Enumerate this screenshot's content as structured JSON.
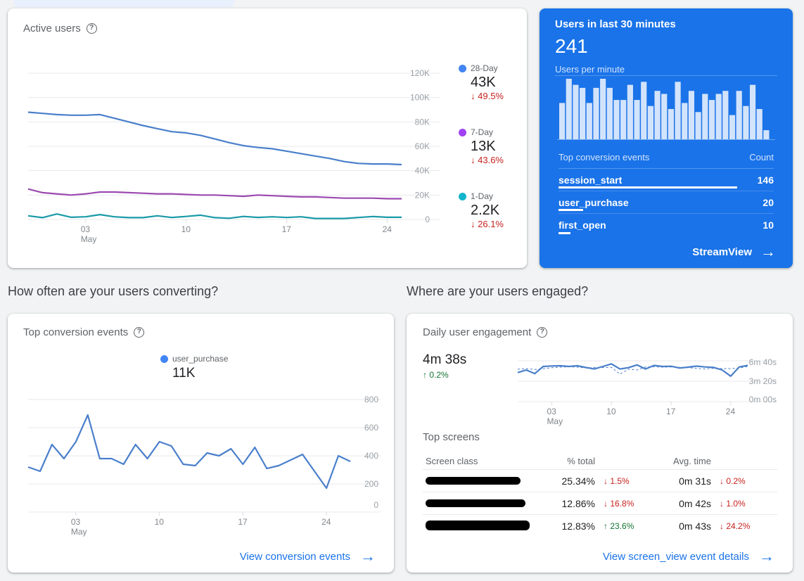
{
  "active_users": {
    "title": "Active users",
    "legend": [
      {
        "label": "28-Day",
        "value": "43K",
        "change": "49.5%",
        "direction": "down",
        "color": "#4285f4"
      },
      {
        "label": "7-Day",
        "value": "13K",
        "change": "43.6%",
        "direction": "down",
        "color": "#a142f4"
      },
      {
        "label": "1-Day",
        "value": "2.2K",
        "change": "26.1%",
        "direction": "down",
        "color": "#12b5cb"
      }
    ]
  },
  "realtime": {
    "title": "Users in last 30 minutes",
    "value": "241",
    "subtitle": "Users per minute",
    "table_header": {
      "name": "Top conversion events",
      "count": "Count"
    },
    "events": [
      {
        "name": "session_start",
        "count": "146",
        "share": 1.0
      },
      {
        "name": "user_purchase",
        "count": "20",
        "share": 0.137
      },
      {
        "name": "first_open",
        "count": "10",
        "share": 0.068
      }
    ],
    "link_label": "StreamView"
  },
  "sections": {
    "converting": "How often are your users converting?",
    "engaged": "Where are your users engaged?"
  },
  "conversions": {
    "title": "Top conversion events",
    "legend_label": "user_purchase",
    "legend_value": "11K",
    "link_label": "View conversion events"
  },
  "engagement": {
    "title": "Daily user engagement",
    "value": "4m 38s",
    "change": "0.2%",
    "screens_title": "Top screens",
    "headers": {
      "screen": "Screen class",
      "pct": "% total",
      "time": "Avg. time"
    },
    "rows": [
      {
        "screen": "[redacted]",
        "pct": "25.34%",
        "pct_change": "1.5%",
        "pct_dir": "down",
        "time": "0m 31s",
        "time_change": "0.2%",
        "time_dir": "down"
      },
      {
        "screen": "[redacted]",
        "pct": "12.86%",
        "pct_change": "16.8%",
        "pct_dir": "down",
        "time": "0m 42s",
        "time_change": "1.0%",
        "time_dir": "down"
      },
      {
        "screen": "[redacted]",
        "pct": "12.83%",
        "pct_change": "23.6%",
        "pct_dir": "up",
        "time": "0m 43s",
        "time_change": "24.2%",
        "time_dir": "down"
      }
    ],
    "link_label": "View screen_view event details"
  },
  "chart_data": [
    {
      "id": "active_users",
      "type": "line",
      "title": "Active users",
      "x_ticks": [
        {
          "label": "03",
          "sub": "May",
          "index": 4
        },
        {
          "label": "10",
          "index": 11
        },
        {
          "label": "17",
          "index": 18
        },
        {
          "label": "24",
          "index": 25
        }
      ],
      "y_ticks": [
        "0",
        "20K",
        "40K",
        "60K",
        "80K",
        "100K",
        "120K"
      ],
      "ylim": [
        0,
        120000
      ],
      "series": [
        {
          "name": "28-Day",
          "color": "#4a7fcb",
          "values": [
            88000,
            87000,
            86000,
            85500,
            85500,
            86000,
            83000,
            80000,
            77000,
            74500,
            72000,
            71000,
            69000,
            66000,
            63000,
            60500,
            59000,
            58000,
            56000,
            54000,
            52000,
            50000,
            47500,
            46000,
            45500,
            45500,
            45000
          ]
        },
        {
          "name": "7-Day",
          "color": "#9c4ab0",
          "values": [
            25000,
            22000,
            21000,
            20000,
            21000,
            22500,
            22500,
            22000,
            21500,
            21000,
            21000,
            20500,
            20000,
            20000,
            19500,
            19000,
            20000,
            19500,
            19000,
            18500,
            18500,
            18000,
            17500,
            17500,
            17500,
            17000,
            17000
          ]
        },
        {
          "name": "1-Day",
          "color": "#1a9aa8",
          "values": [
            3000,
            1500,
            4500,
            1800,
            2200,
            4000,
            2200,
            1500,
            1500,
            3000,
            1600,
            2500,
            3500,
            1500,
            1000,
            2500,
            1700,
            2200,
            1600,
            2200,
            800,
            800,
            800,
            1600,
            2400,
            1800,
            1800
          ]
        }
      ]
    },
    {
      "id": "conversions",
      "type": "line",
      "title": "Top conversion events",
      "legend": [
        "user_purchase"
      ],
      "x_ticks": [
        {
          "label": "03",
          "sub": "May",
          "index": 4
        },
        {
          "label": "10",
          "index": 11
        },
        {
          "label": "17",
          "index": 18
        },
        {
          "label": "24",
          "index": 25
        }
      ],
      "y_ticks": [
        "0",
        "200",
        "400",
        "600",
        "800"
      ],
      "ylim": [
        0,
        800
      ],
      "series": [
        {
          "name": "user_purchase",
          "color": "#4a7fcb",
          "values": [
            320,
            290,
            480,
            380,
            500,
            690,
            380,
            380,
            340,
            480,
            380,
            500,
            470,
            340,
            330,
            420,
            400,
            450,
            340,
            460,
            310,
            330,
            370,
            410,
            290,
            170,
            400,
            360
          ]
        }
      ]
    },
    {
      "id": "engagement",
      "type": "line",
      "title": "Daily user engagement",
      "x_ticks": [
        {
          "label": "03",
          "sub": "May",
          "index": 4
        },
        {
          "label": "10",
          "index": 11
        },
        {
          "label": "17",
          "index": 18
        },
        {
          "label": "24",
          "index": 25
        }
      ],
      "y_ticks": [
        "0m 00s",
        "3m 20s",
        "6m 40s"
      ],
      "ylim_seconds": [
        0,
        400
      ],
      "series": [
        {
          "name": "current",
          "style": "solid",
          "color": "#4a7fcb",
          "values": [
            285,
            310,
            275,
            345,
            350,
            352,
            345,
            352,
            335,
            320,
            345,
            370,
            320,
            333,
            360,
            320,
            355,
            345,
            347,
            330,
            338,
            348,
            340,
            335,
            310,
            250,
            340,
            355
          ]
        },
        {
          "name": "previous",
          "style": "dashed",
          "color": "#4a7fcb",
          "values": [
            318,
            324,
            316,
            322,
            333,
            338,
            342,
            338,
            330,
            336,
            334,
            336,
            270,
            318,
            310,
            340,
            342,
            338,
            340,
            336,
            335,
            325,
            320,
            327,
            324,
            324,
            330,
            345
          ]
        }
      ]
    },
    {
      "id": "users_per_minute",
      "type": "bar",
      "title": "Users per minute",
      "values": [
        6,
        10,
        9,
        8.5,
        6,
        8.5,
        10,
        8.5,
        6.5,
        6.5,
        9,
        6.5,
        9.5,
        5.5,
        8,
        7.5,
        5,
        9.5,
        6,
        8,
        4.5,
        7.5,
        6.5,
        7.5,
        8,
        4,
        8,
        5.5,
        9,
        5,
        1.5
      ],
      "ylim": [
        0,
        10
      ]
    }
  ]
}
